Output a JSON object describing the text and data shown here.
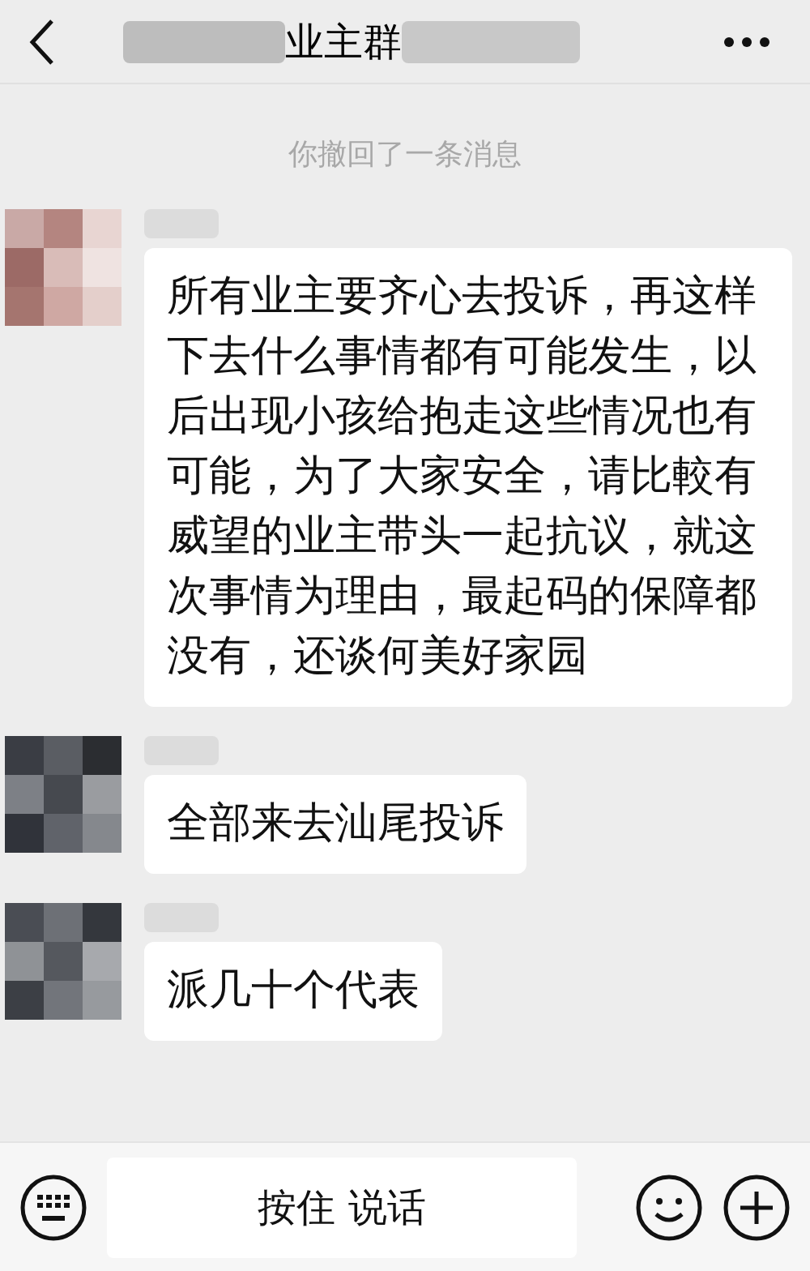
{
  "header": {
    "title": "业主群"
  },
  "system_notice": "你撤回了一条消息",
  "messages": [
    {
      "text": "所有业主要齐心去投诉，再这样下去什么事情都有可能发生，以后出现小孩给抱走这些情况也有可能，为了大家安全，请比較有威望的业主带头一起抗议，就这次事情为理由，最起码的保障都没有，还谈何美好家园"
    },
    {
      "text": "全部来去汕尾投诉"
    },
    {
      "text": "派几十个代表"
    }
  ],
  "input_bar": {
    "voice_button": "按住 说话"
  }
}
